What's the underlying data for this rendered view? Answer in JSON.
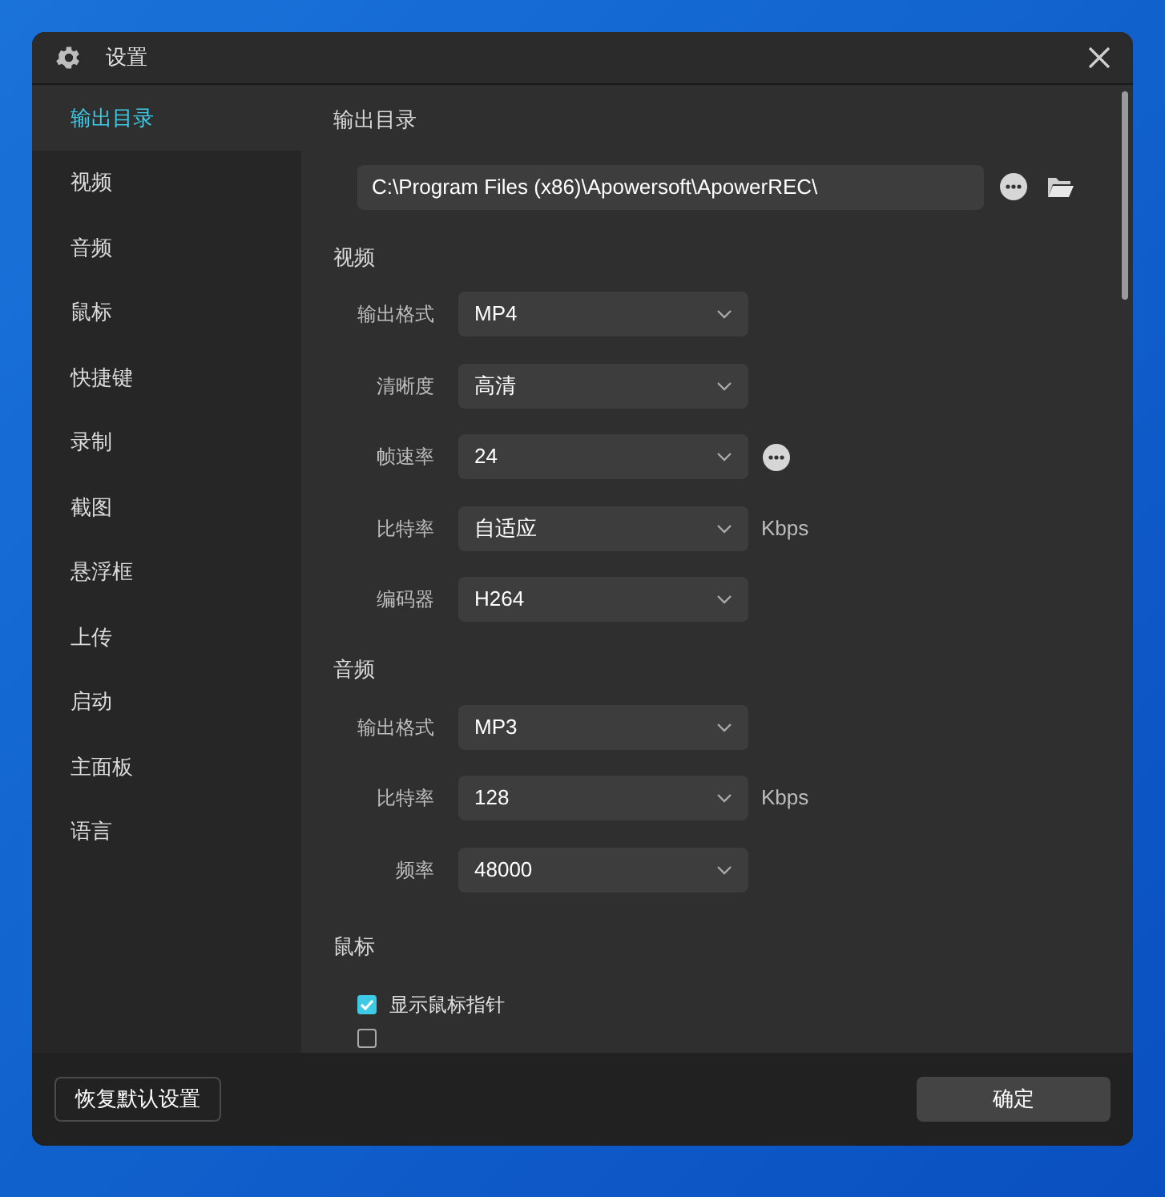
{
  "window": {
    "title": "设置"
  },
  "sidebar": {
    "items": [
      {
        "label": "输出目录",
        "selected": true
      },
      {
        "label": "视频",
        "selected": false
      },
      {
        "label": "音频",
        "selected": false
      },
      {
        "label": "鼠标",
        "selected": false
      },
      {
        "label": "快捷键",
        "selected": false
      },
      {
        "label": "录制",
        "selected": false
      },
      {
        "label": "截图",
        "selected": false
      },
      {
        "label": "悬浮框",
        "selected": false
      },
      {
        "label": "上传",
        "selected": false
      },
      {
        "label": "启动",
        "selected": false
      },
      {
        "label": "主面板",
        "selected": false
      },
      {
        "label": "语言",
        "selected": false
      }
    ]
  },
  "output_directory": {
    "heading": "输出目录",
    "path": "C:\\Program Files (x86)\\Apowersoft\\ApowerREC\\"
  },
  "video": {
    "heading": "视频",
    "rows": [
      {
        "label": "输出格式",
        "value": "MP4"
      },
      {
        "label": "清晰度",
        "value": "高清"
      },
      {
        "label": "帧速率",
        "value": "24",
        "more": true
      },
      {
        "label": "比特率",
        "value": "自适应",
        "unit": "Kbps"
      },
      {
        "label": "编码器",
        "value": "H264"
      }
    ]
  },
  "audio": {
    "heading": "音频",
    "rows": [
      {
        "label": "输出格式",
        "value": "MP3"
      },
      {
        "label": "比特率",
        "value": "128",
        "unit": "Kbps"
      },
      {
        "label": "频率",
        "value": "48000"
      }
    ]
  },
  "mouse": {
    "heading": "鼠标",
    "options": [
      {
        "label": "显示鼠标指针",
        "checked": true
      },
      {
        "checked": false
      }
    ]
  },
  "footer": {
    "reset_button": "恢复默认设置",
    "ok_button": "确定"
  }
}
